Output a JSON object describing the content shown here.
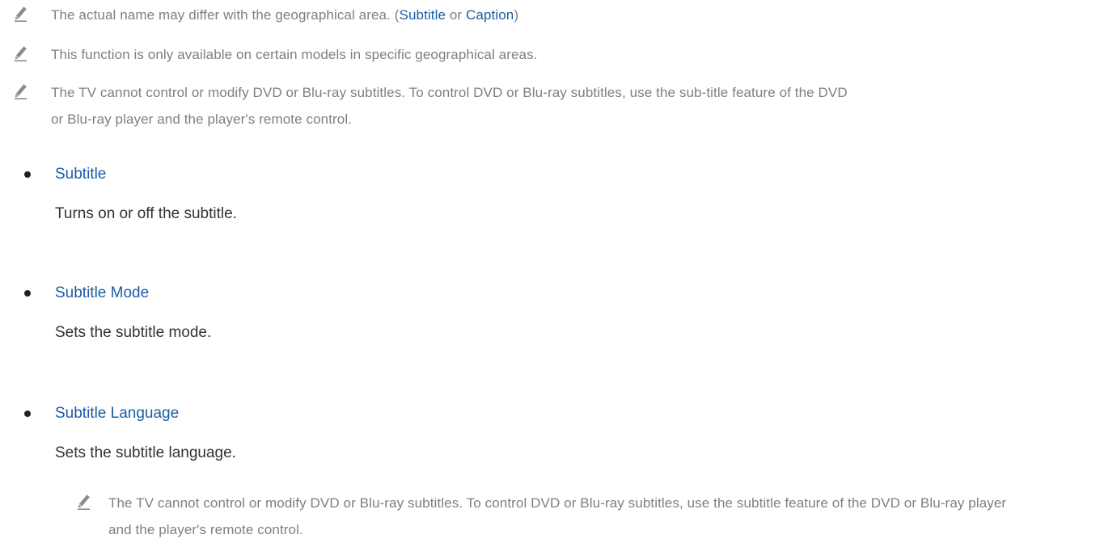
{
  "notes": [
    {
      "text_before": "The actual name may differ with the geographical area. (",
      "link1": "Subtitle",
      "joiner": " or ",
      "link2": "Caption",
      "text_after": ")"
    },
    {
      "text": "This function is only available on certain models in specific geographical areas."
    },
    {
      "text": "The TV cannot control or modify DVD or Blu-ray subtitles. To control DVD or Blu-ray subtitles, use the sub-title feature of the DVD or Blu-ray player and the player's remote control."
    }
  ],
  "items": [
    {
      "title": "Subtitle",
      "desc": "Turns on or off the subtitle."
    },
    {
      "title": "Subtitle Mode",
      "desc": "Sets the subtitle mode."
    },
    {
      "title": "Subtitle Language",
      "desc": "Sets the subtitle language."
    }
  ],
  "sub_note": {
    "text": "The TV cannot control or modify DVD or Blu-ray subtitles. To control DVD or Blu-ray subtitles, use the subtitle feature of the DVD or Blu-ray player and the player's remote control."
  },
  "colors": {
    "link": "#1b5da5",
    "note_text": "#7f7f7f",
    "body_text": "#333333",
    "icon": "#8a8a8a"
  },
  "icons": {
    "note": "pencil-icon"
  }
}
